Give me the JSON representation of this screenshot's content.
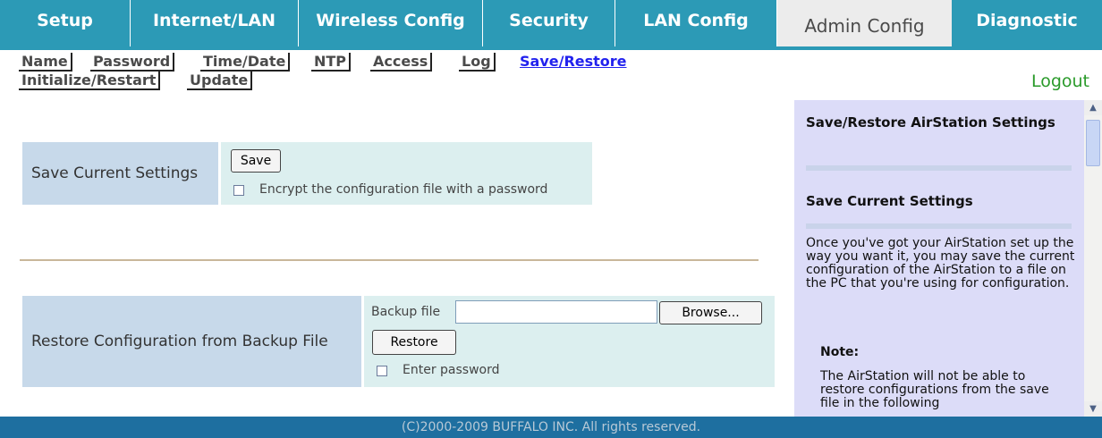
{
  "tabs": [
    {
      "label": "Setup"
    },
    {
      "label": "Internet/LAN"
    },
    {
      "label": "Wireless Config"
    },
    {
      "label": "Security"
    },
    {
      "label": "LAN Config"
    },
    {
      "label": "Admin Config",
      "active": true
    },
    {
      "label": "Diagnostic"
    }
  ],
  "subnav": {
    "items": [
      "Name",
      "Password",
      "Time/Date",
      "NTP",
      "Access",
      "Log",
      "Save/Restore",
      "Initialize/Restart",
      "Update"
    ],
    "active": "Save/Restore"
  },
  "logout_label": "Logout",
  "save_section": {
    "label": "Save Current Settings",
    "save_button": "Save",
    "encrypt_checkbox": {
      "label": "Encrypt the configuration file with a password",
      "checked": false
    }
  },
  "restore_section": {
    "label": "Restore Configuration from Backup File",
    "backup_file_label": "Backup file",
    "backup_file_value": "",
    "browse_button": "Browse...",
    "restore_button": "Restore",
    "password_checkbox": {
      "label": "Enter password",
      "checked": false
    }
  },
  "help": {
    "title": "Save/Restore AirStation Settings",
    "section_title": "Save Current Settings",
    "body": "Once you've got your AirStation set up the way you want it, you may save the current configuration of the AirStation to a file on the PC that you're using for configuration.",
    "note_title": "Note:",
    "note_body": "The AirStation will not be able to restore configurations from the save file in the following"
  },
  "icons": {
    "scroll_up": "scroll-up-arrow-icon",
    "scroll_down": "scroll-down-arrow-icon"
  },
  "footer": "(C)2000-2009 BUFFALO INC. All rights reserved.",
  "colors": {
    "tab_bg": "#2c9ab6",
    "active_tab_bg": "#ececec",
    "label_bg": "#c7d9ea",
    "control_bg": "#dcefef",
    "help_bg": "#dcdcf8",
    "footer_bg": "#1e6fa0",
    "logout": "#2a9a2a",
    "active_link": "#2222ee"
  }
}
